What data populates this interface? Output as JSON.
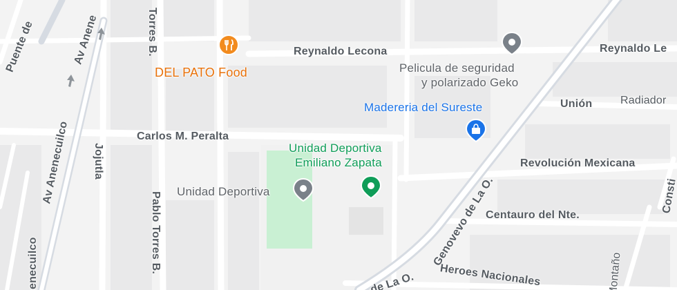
{
  "roads": {
    "reynaldo_lecona": "Reynaldo Lecona",
    "reynaldo_lecona_right": "Reynaldo Le",
    "union": "Unión",
    "radiador": "Radiador",
    "carlos_peralta": "Carlos M. Peralta",
    "revolucion": "Revolución Mexicana",
    "centauro": "Centauro del Nte.",
    "genovevo": "Genovevo de La O.",
    "genovevo_lower": "de La O.",
    "heroes": "Heroes Nacionales",
    "puente": "Puente de",
    "av_anenecuilco_top": "Av Anene",
    "av_anenecuilco_mid": "Av Anenecuilco",
    "anenecuilco_bottom": "nenecuilco",
    "jojutla": "Jojutla",
    "pablo_torres_top": "Torres B.",
    "pablo_torres": "Pablo Torres B.",
    "constitucion": "Consti",
    "montano": "Montaño"
  },
  "places": {
    "del_pato": {
      "name": "DEL PATO Food",
      "color": "#e8710a",
      "icon": "restaurant-icon"
    },
    "geko": {
      "line1": "Pelicula de seguridad",
      "line2": "y polarizado Geko",
      "icon": "place-pin-icon"
    },
    "madereria": {
      "name": "Madereria del Sureste",
      "color": "#1a73e8",
      "icon": "shopping-bag-icon"
    },
    "unidad_zapata": {
      "line1": "Unidad Deportiva",
      "line2": "Emiliano Zapata",
      "color": "#0f9d58",
      "icon": "park-pin-icon"
    },
    "unidad_deportiva": {
      "name": "Unidad Deportiva",
      "icon": "place-pin-icon"
    }
  },
  "colors": {
    "background": "#f3f3f3",
    "road": "#ffffff",
    "major_road": "#d9dde3",
    "park": "#c9f0d3",
    "block": "#e8e8e8"
  }
}
